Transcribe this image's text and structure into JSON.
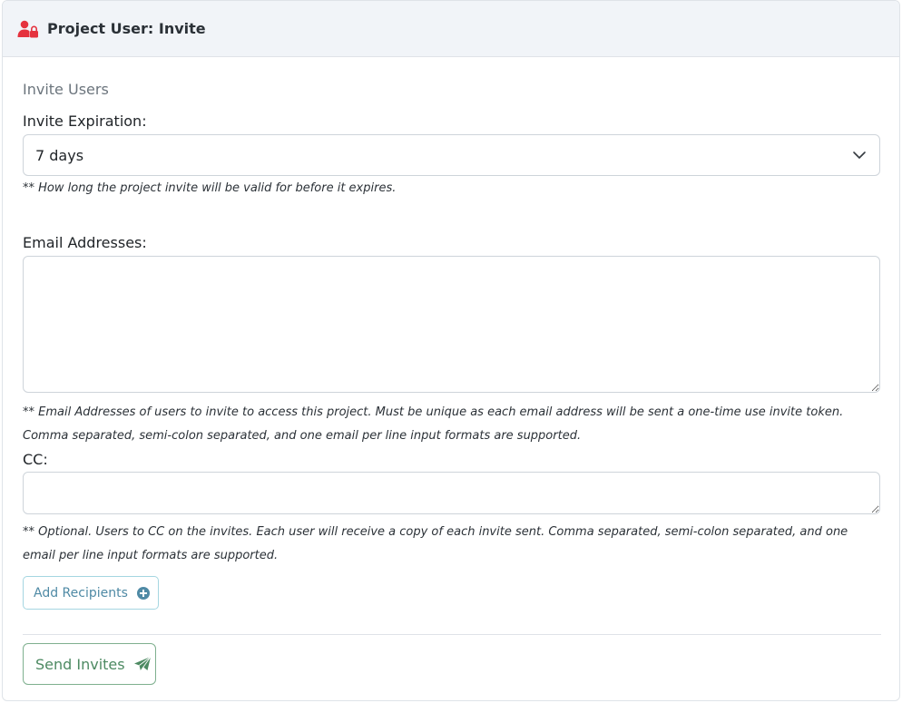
{
  "header": {
    "title": "Project User: Invite",
    "icon": "user-lock-icon",
    "icon_color": "#e5323e"
  },
  "section": {
    "title": "Invite Users"
  },
  "expiration": {
    "label": "Invite Expiration:",
    "selected": "7 days",
    "help": "** How long the project invite will be valid for before it expires."
  },
  "emails": {
    "label": "Email Addresses:",
    "value": "",
    "help": "** Email Addresses of users to invite to access this project. Must be unique as each email address will be sent a one-time use invite token. Comma separated, semi-colon separated, and one email per line input formats are supported."
  },
  "cc": {
    "label": "CC:",
    "value": "",
    "help": "** Optional. Users to CC on the invites. Each user will receive a copy of each invite sent. Comma separated, semi-colon separated, and one email per line input formats are supported."
  },
  "buttons": {
    "add_recipients": "Add Recipients",
    "send_invites": "Send Invites"
  },
  "colors": {
    "accent_info": "#4f8aa5",
    "accent_success": "#4d8a62"
  }
}
